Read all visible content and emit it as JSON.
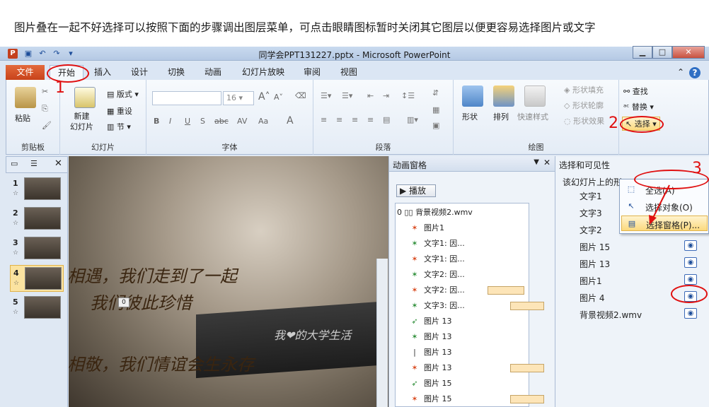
{
  "caption": "图片叠在一起不好选择可以按照下面的步骤调出图层菜单，可点击眼睛图标暂时关闭其它图层以便更容易选择图片或文字",
  "window": {
    "app_icon": "P",
    "title": "同学会PPT131227.pptx - Microsoft PowerPoint",
    "min": "▁",
    "max": "□",
    "close": "✕",
    "qat": [
      "save-icon",
      "undo-icon",
      "redo-icon",
      "customize-icon"
    ]
  },
  "tabs": {
    "file": "文件",
    "items": [
      "开始",
      "插入",
      "设计",
      "切换",
      "动画",
      "幻灯片放映",
      "审阅",
      "视图"
    ],
    "help": "?"
  },
  "ribbon": {
    "clipboard": {
      "label": "剪贴板",
      "paste": "粘贴"
    },
    "slides": {
      "label": "幻灯片",
      "new_slide": "新建\n幻灯片",
      "layout": "版式",
      "reset": "重设",
      "section": "节"
    },
    "font": {
      "label": "字体",
      "size": "16",
      "bold": "B",
      "italic": "I",
      "underline": "U",
      "shadow": "S",
      "strike": "abc",
      "spacing": "AV",
      "case": "Aa",
      "color": "A",
      "grow": "A",
      "shrink": "A"
    },
    "paragraph": {
      "label": "段落"
    },
    "drawing": {
      "label": "绘图",
      "shapes": "形状",
      "arrange": "排列",
      "quick_styles": "快速样式",
      "fill": "形状填充",
      "outline": "形状轮廓",
      "effects": "形状效果"
    },
    "editing": {
      "find": "查找",
      "replace": "替换",
      "select": "选择"
    }
  },
  "dropdown": {
    "items": [
      "全选(A)",
      "选择对象(O)",
      "选择窗格(P)..."
    ]
  },
  "slides_panel": {
    "thumbs": [
      {
        "num": "1"
      },
      {
        "num": "2"
      },
      {
        "num": "3"
      },
      {
        "num": "4"
      },
      {
        "num": "5"
      }
    ],
    "star": "☆"
  },
  "slide": {
    "line1": "相遇，我们走到了一起",
    "line2": "我们彼此珍惜",
    "line3": "相敬，我们情谊会生永存",
    "board_text": "我❤的大学生活",
    "tag": "0"
  },
  "animation_pane": {
    "title": "动画窗格",
    "play": "播放",
    "items": [
      {
        "label": "0 ▯▯ 背景视频2.wmv",
        "icon": "video-icon",
        "bar": ""
      },
      {
        "label": "图片1",
        "icon": "red-star-icon",
        "bar": ""
      },
      {
        "label": "文字1: 因...",
        "icon": "green-star-icon",
        "bar": ""
      },
      {
        "label": "文字1: 因...",
        "icon": "red-star-icon",
        "bar": ""
      },
      {
        "label": "文字2: 因...",
        "icon": "green-star-icon",
        "bar": ""
      },
      {
        "label": "文字2: 因...",
        "icon": "red-star-icon",
        "bar": "a"
      },
      {
        "label": "文字3: 因...",
        "icon": "green-star-icon",
        "bar": "b"
      },
      {
        "label": "图片 13",
        "icon": "green-path-icon",
        "bar": ""
      },
      {
        "label": "图片 13",
        "icon": "green-star-icon",
        "bar": ""
      },
      {
        "label": "图片 13",
        "icon": "line-icon",
        "bar": ""
      },
      {
        "label": "图片 13",
        "icon": "red-star-icon",
        "bar": "b"
      },
      {
        "label": "图片 15",
        "icon": "green-path-icon",
        "bar": ""
      },
      {
        "label": "图片 15",
        "icon": "red-star-icon",
        "bar": "b"
      }
    ]
  },
  "selection_pane": {
    "title": "选择和可见性",
    "subtitle": "该幻灯片上的形",
    "items": [
      "文字1",
      "文字3",
      "文字2",
      "图片 15",
      "图片 13",
      "图片1",
      "图片 4",
      "背景视频2.wmv"
    ]
  },
  "annotations": {
    "n1": "1",
    "n2": "2",
    "n3": "3"
  },
  "colors": {
    "accent": "#c8421a",
    "annotation": "#e01010",
    "selection": "#fbd97e"
  }
}
